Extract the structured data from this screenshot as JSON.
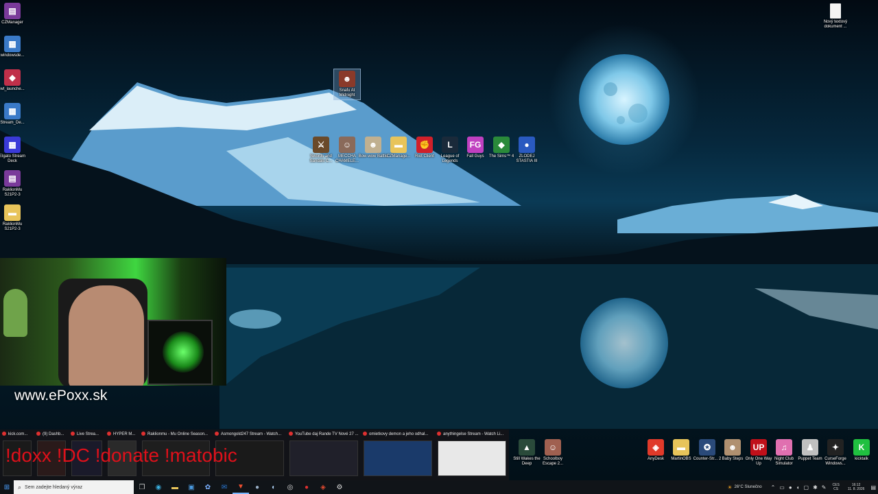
{
  "desktop_left": [
    {
      "label": "CZManager",
      "icon": "rar-icon",
      "color": "#7a3a9a",
      "glyph": "▤"
    },
    {
      "label": "windowsde...",
      "icon": "installer-icon",
      "color": "#3a7ac8",
      "glyph": "▦"
    },
    {
      "label": "wt_launche...",
      "icon": "launcher-icon",
      "color": "#c0304a",
      "glyph": "◆"
    },
    {
      "label": "Stream_De...",
      "icon": "installer-icon",
      "color": "#3a7ac8",
      "glyph": "▦"
    },
    {
      "label": "Elgato Stream Deck",
      "icon": "stream-deck-icon",
      "color": "#3a3ad8",
      "glyph": "▦"
    },
    {
      "label": "RaklionMu S21P2-3",
      "icon": "rar-icon",
      "color": "#7a3a9a",
      "glyph": "▤"
    },
    {
      "label": "RaklionMu S21P2-3",
      "icon": "folder-icon",
      "color": "#e8c45a",
      "glyph": "▬"
    }
  ],
  "desktop_top_right": {
    "label": "Nový textový dokument ...",
    "icon": "text-file-icon"
  },
  "desktop_center_single": {
    "label": "Snafu At Midnight",
    "icon": "game-icon"
  },
  "desktop_center_row": [
    {
      "label": "Swords and Sandals C...",
      "color": "#6a4a2a",
      "glyph": "⚔"
    },
    {
      "label": "MECCHA CHAMELE...",
      "color": "#8a6a5a",
      "glyph": "☺"
    },
    {
      "label": "Bow-wow Battle",
      "color": "#c0b090",
      "glyph": "☻"
    },
    {
      "label": "CZManage...",
      "color": "#e8c45a",
      "glyph": "▬"
    },
    {
      "label": "Riot Client",
      "color": "#d0202a",
      "glyph": "✊"
    },
    {
      "label": "League of Legends",
      "color": "#1a2a3a",
      "glyph": "L"
    },
    {
      "label": "Fall Guys",
      "color": "#c040c0",
      "glyph": "FG"
    },
    {
      "label": "The Sims™ 4",
      "color": "#2a8a3a",
      "glyph": "◆"
    },
    {
      "label": "ZLODEJ STASTIA III",
      "color": "#2a5ac0",
      "glyph": "●"
    }
  ],
  "desktop_bottom_mid": [
    {
      "label": "Still Wakes the Deep",
      "color": "#2a4a3a",
      "glyph": "▲"
    },
    {
      "label": "Schoolboy Escape 2...",
      "color": "#a06050",
      "glyph": "☺"
    }
  ],
  "desktop_bottom_right": [
    {
      "label": "AnyDesk",
      "color": "#e03a2a",
      "glyph": "◈"
    },
    {
      "label": "MartinOBS",
      "color": "#e8c45a",
      "glyph": "▬"
    },
    {
      "label": "Counter-Str... 2",
      "color": "#2a4a7a",
      "glyph": "✪"
    },
    {
      "label": "Baby Steps",
      "color": "#b09070",
      "glyph": "☻"
    },
    {
      "label": "Only One Way Up",
      "color": "#c0101a",
      "glyph": "UP"
    },
    {
      "label": "Night Club Simulator",
      "color": "#e070b0",
      "glyph": "♫"
    },
    {
      "label": "Puppet Team",
      "color": "#c0c0c0",
      "glyph": "♟"
    },
    {
      "label": "CurseForge Windows...",
      "color": "#222222",
      "glyph": "✦"
    },
    {
      "label": "kicktalk",
      "color": "#20c040",
      "glyph": "K"
    }
  ],
  "webcam": {
    "website": "www.ePoxx.sk"
  },
  "overlay_text": "!doxx !DC !donate !matobic",
  "tasks": [
    {
      "title": "kick.com..."
    },
    {
      "title": "(9) Dashb..."
    },
    {
      "title": "Live Strea..."
    },
    {
      "title": "HYPER M..."
    },
    {
      "title": "Raklionmu - Mu Online Season..."
    },
    {
      "title": "Asmongold247 Stream - Watch..."
    },
    {
      "title": "YouTube daj Rande TV Nové 27 ..."
    },
    {
      "title": "omietkovy demon a jeho odhal..."
    },
    {
      "title": "anythingelse Stream - Watch Li..."
    }
  ],
  "taskbar": {
    "search_placeholder": "Sem zadejte hledaný výraz",
    "weather": "26°C  Slunečno",
    "lang": "CES",
    "lang2": "CS",
    "time": "16:12",
    "date": "11. 8. 2026"
  }
}
